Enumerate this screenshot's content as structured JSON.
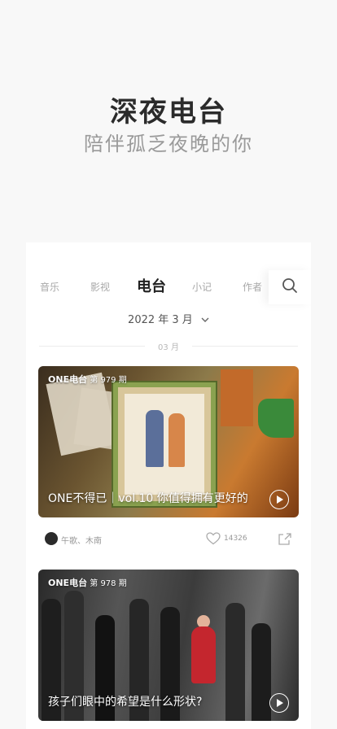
{
  "hero": {
    "title": "深夜电台",
    "subtitle": "陪伴孤乏夜晚的你"
  },
  "tabs": [
    {
      "label": "音乐",
      "active": false
    },
    {
      "label": "影视",
      "active": false
    },
    {
      "label": "电台",
      "active": true
    },
    {
      "label": "小记",
      "active": false
    },
    {
      "label": "作者",
      "active": false
    }
  ],
  "search": {
    "icon": "search-icon"
  },
  "date_picker": {
    "label": "2022 年 3 月",
    "icon": "chevron-down-icon"
  },
  "month_divider": "03 月",
  "cards": [
    {
      "brand": "ONE电台",
      "issue": "第 979 期",
      "title": "ONE不得已｜vol.10 你值得拥有更好的",
      "authors": "午歌、木南",
      "likes": "14326"
    },
    {
      "brand": "ONE电台",
      "issue": "第 978 期",
      "title": "孩子们眼中的希望是什么形状?"
    }
  ],
  "colors": {
    "background": "#f8f8f8",
    "panel": "#ffffff",
    "active_tab": "#222222",
    "inactive_tab": "#a8a8a8"
  }
}
